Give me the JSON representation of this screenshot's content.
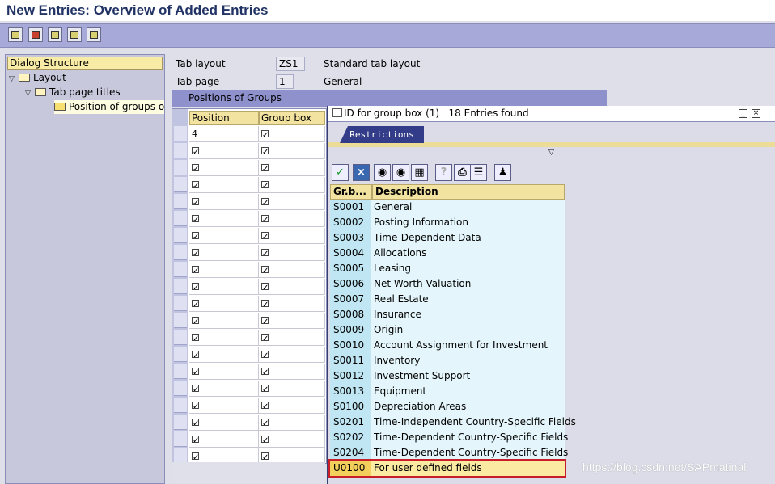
{
  "window": {
    "title": "New Entries: Overview of Added Entries"
  },
  "tree": {
    "header": "Dialog Structure",
    "nodes": [
      "Layout",
      "Tab page titles",
      "Position of groups or"
    ]
  },
  "fields": {
    "tab_layout_label": "Tab layout",
    "tab_layout_value": "ZS1",
    "tab_layout_desc": "Standard tab layout",
    "tab_page_label": "Tab page",
    "tab_page_value": "1",
    "tab_page_desc": "General"
  },
  "groups": {
    "section_title": "Positions of Groups",
    "col_position": "Position",
    "col_groupbox": "Group box",
    "first_position": "4"
  },
  "popup": {
    "title": "ID for group box (1)",
    "count_text": "18 Entries found",
    "tab_label": "Restrictions",
    "col_key": "Gr.b...",
    "col_desc": "Description",
    "rows": [
      {
        "key": "S0001",
        "desc": "General"
      },
      {
        "key": "S0002",
        "desc": "Posting Information"
      },
      {
        "key": "S0003",
        "desc": "Time-Dependent Data"
      },
      {
        "key": "S0004",
        "desc": "Allocations"
      },
      {
        "key": "S0005",
        "desc": "Leasing"
      },
      {
        "key": "S0006",
        "desc": "Net Worth Valuation"
      },
      {
        "key": "S0007",
        "desc": "Real Estate"
      },
      {
        "key": "S0008",
        "desc": "Insurance"
      },
      {
        "key": "S0009",
        "desc": "Origin"
      },
      {
        "key": "S0010",
        "desc": "Account Assignment for Investment"
      },
      {
        "key": "S0011",
        "desc": "Inventory"
      },
      {
        "key": "S0012",
        "desc": "Investment Support"
      },
      {
        "key": "S0013",
        "desc": "Equipment"
      },
      {
        "key": "S0100",
        "desc": "Depreciation Areas"
      },
      {
        "key": "S0201",
        "desc": "Time-Independent Country-Specific Fields"
      },
      {
        "key": "S0202",
        "desc": "Time-Dependent Country-Specific Fields"
      },
      {
        "key": "S0204",
        "desc": "Time-Dependent Country-Specific Fields"
      },
      {
        "key": "U0100",
        "desc": "For user defined fields"
      }
    ]
  },
  "watermark": "https://blog.csdn.net/SAPmatinal"
}
